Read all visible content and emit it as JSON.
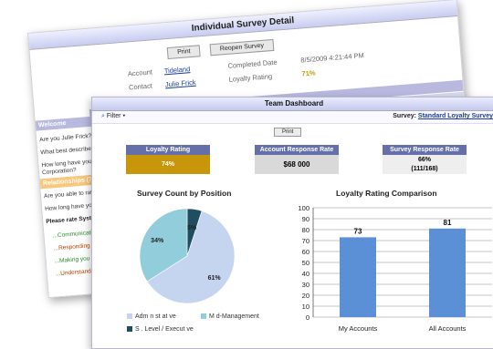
{
  "back_window": {
    "title": "Individual Survey Detail",
    "print_label": "Print",
    "reopen_label": "Reopen Survey",
    "account_label": "Account",
    "account_value": "Tideland",
    "contact_label": "Contact",
    "contact_value": "Julie Frick",
    "completed_label": "Completed Date",
    "completed_value": "8/5/2009 4:21:44 PM",
    "loyalty_label": "Loyalty Rating",
    "loyalty_value": "71%",
    "welcome": "Welcome",
    "questions": [
      "Are you Julie Frick?",
      "What best described your",
      "How long have you perso",
      "Corporation?"
    ],
    "relationships": "Relationships (71%",
    "questions2": [
      "Are you able to rate Syst",
      "How long have you and"
    ],
    "rate_heading": "Please rate System A",
    "answers": [
      "...Communicating in a",
      "...Responding promptly",
      "...Making you feel like",
      "...Understanding your"
    ]
  },
  "front_window": {
    "title": "Team Dashboard",
    "filter_label": "Filter",
    "survey_label": "Survey:",
    "survey_link": "Standard Loyalty Survey",
    "print_label": "Print",
    "tiles": [
      {
        "header": "Loyalty Rating",
        "value": "74%",
        "color": "#c8960a"
      },
      {
        "header": "Account Response Rate",
        "value": "$68 000",
        "color": "#d9d9d9"
      },
      {
        "header": "Survey Response Rate",
        "value": "66%",
        "value2": "(111/168)",
        "color": "#eeeeee"
      }
    ]
  },
  "chart_data": [
    {
      "type": "pie",
      "title": "Survey Count by Position",
      "categories": [
        "Adm n st at ve",
        "M d-Management",
        "S . Level / Execut ve"
      ],
      "values": [
        61,
        34,
        5
      ],
      "labels": [
        "61%",
        "34%",
        "5%"
      ],
      "colors": [
        "#c5d5ef",
        "#92cddc",
        "#1f4e60"
      ]
    },
    {
      "type": "bar",
      "title": "Loyalty Rating Comparison",
      "categories": [
        "My Accounts",
        "All Accounts"
      ],
      "values": [
        73,
        81
      ],
      "ylim": [
        0,
        100
      ],
      "yticks": [
        0,
        10,
        20,
        30,
        40,
        50,
        60,
        70,
        80,
        90,
        100
      ],
      "grid": true,
      "color": "#5b8fd6"
    }
  ]
}
